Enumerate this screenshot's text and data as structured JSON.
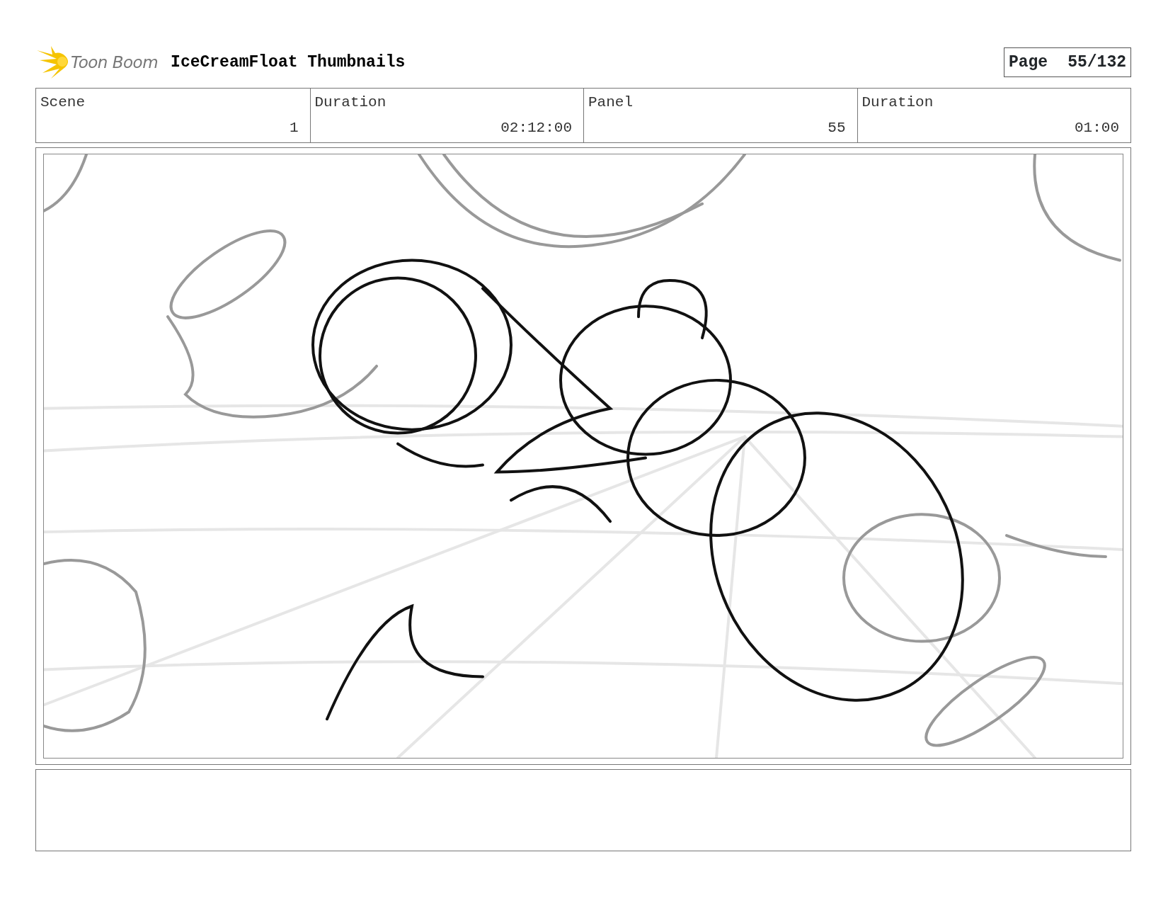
{
  "header": {
    "logo_text": "Toon Boom",
    "title": "IceCreamFloat Thumbnails",
    "page_label": "Page",
    "page_number": "55/132"
  },
  "fields": [
    {
      "label": "Scene",
      "value": "1"
    },
    {
      "label": "Duration",
      "value": "02:12:00"
    },
    {
      "label": "Panel",
      "value": "55"
    },
    {
      "label": "Duration",
      "value": "01:00"
    }
  ]
}
